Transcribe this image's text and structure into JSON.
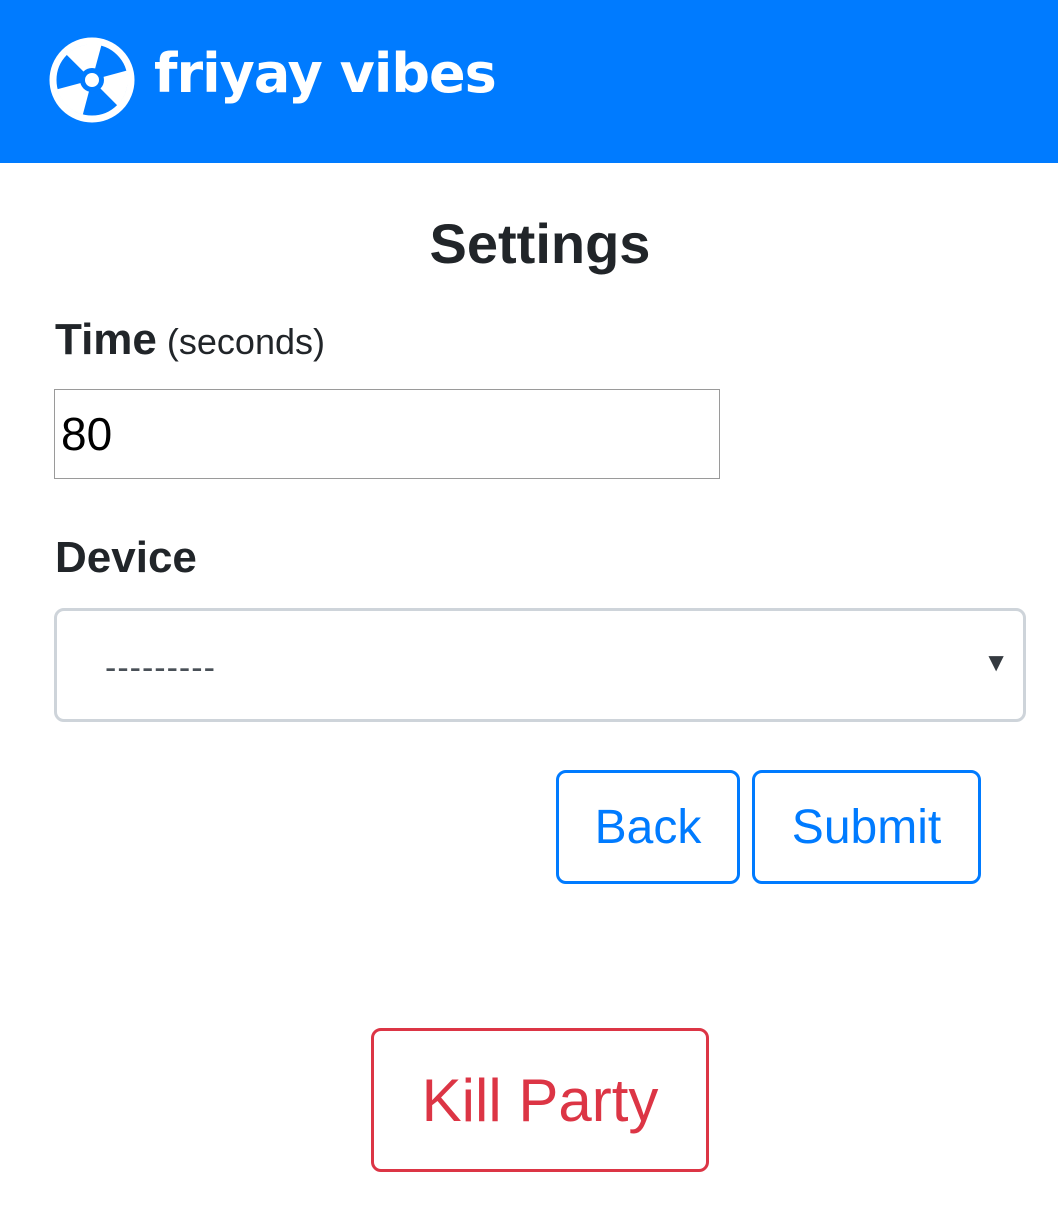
{
  "brand": {
    "name": "friyay vibes",
    "logo_icon": "fan-icon",
    "navbar_color": "#007bff"
  },
  "page": {
    "title": "Settings"
  },
  "form": {
    "time_label": "Time",
    "time_hint": "(seconds)",
    "time_value": "80",
    "device_label": "Device",
    "device_selected": "---------"
  },
  "buttons": {
    "back": "Back",
    "submit": "Submit",
    "kill_party": "Kill Party"
  },
  "colors": {
    "primary": "#007bff",
    "danger": "#dc3545",
    "text": "#212529"
  }
}
